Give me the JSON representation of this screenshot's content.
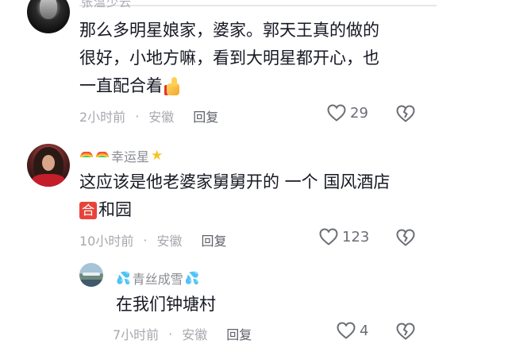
{
  "comments": [
    {
      "username_partial": "张温少云",
      "lines": [
        "那么多明星娘家，婆家。郭天王真的做的",
        "很好，小地方嘛，看到大明星都开心，也",
        "一直配合着"
      ],
      "emoji": "thumbs-up",
      "time": "2小时前",
      "location": "安徽",
      "reply_label": "回复",
      "likes": "29"
    },
    {
      "username": "幸运星",
      "lines": [
        "这应该是他老婆家舅舅开的 一个 国风酒店",
        "和园"
      ],
      "badge": "合",
      "time": "10小时前",
      "location": "安徽",
      "reply_label": "回复",
      "likes": "123"
    },
    {
      "username": "青丝成雪",
      "lines": [
        "在我们钟塘村"
      ],
      "time": "7小时前",
      "location": "安徽",
      "reply_label": "回复",
      "likes": "4"
    }
  ],
  "separator": "·",
  "icons": {
    "like": "heart-outline-icon",
    "dislike": "broken-heart-icon"
  },
  "colors": {
    "text": "#161823",
    "meta": "#a6a8ad",
    "username": "#8a8c93",
    "badge": "#e8433a"
  }
}
